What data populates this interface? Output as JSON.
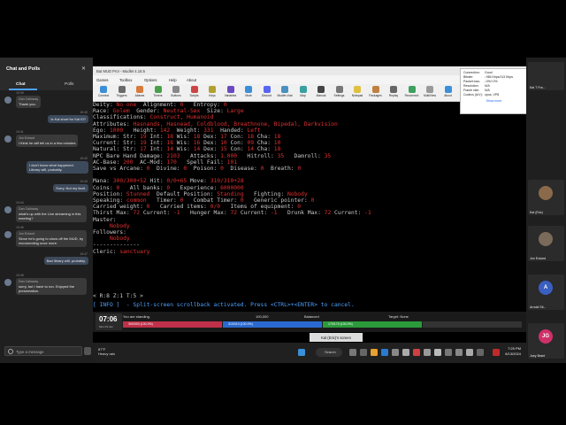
{
  "chat": {
    "title": "Chat and Polls",
    "tabs": [
      "Chat",
      "Polls"
    ],
    "messages": [
      {
        "time": "19:39",
        "sender": "Dan Calloway",
        "text": "Thank you.",
        "me": false
      },
      {
        "time": "19:40",
        "sender": "",
        "text": "Is Kal short for Kal El?",
        "me": true
      },
      {
        "time": "19:41",
        "sender": "Jon Eckard",
        "text": "I think he will tell us in a few minutes",
        "me": false
      },
      {
        "time": "19:42",
        "sender": "",
        "text": "I don't know what happened. Library wifi, probably.",
        "me": true
      },
      {
        "time": "19:43",
        "sender": "",
        "text": "Sorry. Not my fault.",
        "me": true
      },
      {
        "time": "19:44",
        "sender": "Dan Calloway",
        "text": "what's up with the Live streaming in this meeting?",
        "me": false
      },
      {
        "time": "19:45",
        "sender": "Jon Eckard",
        "text": "Since he's going to show off the MUD, try reconnecting once more.",
        "me": false
      },
      {
        "time": "19:47",
        "sender": "",
        "text": "Bad library wifi, probably.",
        "me": true
      },
      {
        "time": "19:48",
        "sender": "Dan Calloway",
        "text": "sorry, but I have to run. Enjoyed the presentation.",
        "me": false
      }
    ],
    "input_placeholder": "Type a message"
  },
  "window": {
    "title": "Bat MUD Pro! - Mudlet 4.18.5",
    "recording_label": "Scrcap",
    "recording_time": "1:59:52",
    "close": "×",
    "menu": [
      "Games",
      "Toolbox",
      "Options",
      "Help",
      "About"
    ],
    "toolbar": [
      {
        "label": "Connect",
        "color": "#3a8fd8"
      },
      {
        "label": "Triggers",
        "color": "#6a6a6a"
      },
      {
        "label": "Aliases",
        "color": "#d87a3a"
      },
      {
        "label": "Timers",
        "color": "#4aa04a"
      },
      {
        "label": "Buttons",
        "color": "#888888"
      },
      {
        "label": "Scripts",
        "color": "#cc4444"
      },
      {
        "label": "Keys",
        "color": "#b0a030"
      },
      {
        "label": "Variables",
        "color": "#6a4ac0"
      },
      {
        "label": "Mute",
        "color": "#3a8fd8"
      },
      {
        "label": "Discord",
        "color": "#5865f2"
      },
      {
        "label": "Mudlet chat",
        "color": "#4a90c0"
      },
      {
        "label": "Map",
        "color": "#3aa0a0"
      },
      {
        "label": "Manual",
        "color": "#444444"
      },
      {
        "label": "Settings",
        "color": "#777777"
      },
      {
        "label": "Notepad",
        "color": "#e0c040"
      },
      {
        "label": "Packages",
        "color": "#c08040"
      },
      {
        "label": "Replay",
        "color": "#666666"
      },
      {
        "label": "Reconnect",
        "color": "#40a060"
      },
      {
        "label": "MultiView",
        "color": "#999999"
      },
      {
        "label": "About",
        "color": "#3a8fd8"
      }
    ]
  },
  "terminal": {
    "lines": [
      [
        [
          "Deity: ",
          "w"
        ],
        [
          "No one",
          "r"
        ],
        [
          "  Alignment: ",
          "w"
        ],
        [
          "0",
          "r"
        ],
        [
          "   Entropy: ",
          "w"
        ],
        [
          "0",
          "r"
        ]
      ],
      [
        [
          "Race: ",
          "w"
        ],
        [
          "Golem",
          "r"
        ],
        [
          "  Gender: ",
          "w"
        ],
        [
          "Neutral-Sex",
          "r"
        ],
        [
          "  Size: ",
          "w"
        ],
        [
          "Large",
          "r"
        ]
      ],
      [
        [
          "Classifications: ",
          "w"
        ],
        [
          "Construct, Humanoid",
          "r"
        ]
      ],
      [
        [
          "Attributes: ",
          "w"
        ],
        [
          "Hasnands, Hasnead, Coldblood, Breathnone, Bipedal, Darkvision",
          "r"
        ]
      ],
      [
        [
          "Ego: ",
          "w"
        ],
        [
          "1000",
          "r"
        ],
        [
          "   Height: ",
          "w"
        ],
        [
          "142",
          "r"
        ],
        [
          "  Weight: ",
          "w"
        ],
        [
          "331",
          "r"
        ],
        [
          "  Handed: ",
          "w"
        ],
        [
          "Left",
          "r"
        ]
      ],
      [
        [
          "Maximum: Str: ",
          "w"
        ],
        [
          "19",
          "r"
        ],
        [
          " Int: ",
          "w"
        ],
        [
          "18",
          "r"
        ],
        [
          " Wis: ",
          "w"
        ],
        [
          "18",
          "r"
        ],
        [
          " Dex: ",
          "w"
        ],
        [
          "17",
          "r"
        ],
        [
          " Con: ",
          "w"
        ],
        [
          "18",
          "r"
        ],
        [
          " Cha: ",
          "w"
        ],
        [
          "18",
          "r"
        ]
      ],
      [
        [
          "Current: Str: ",
          "w"
        ],
        [
          "19",
          "r"
        ],
        [
          " Int: ",
          "w"
        ],
        [
          "18",
          "r"
        ],
        [
          " Wis: ",
          "w"
        ],
        [
          "16",
          "r"
        ],
        [
          " Dex: ",
          "w"
        ],
        [
          "10",
          "r"
        ],
        [
          " Con: ",
          "w"
        ],
        [
          "09",
          "r"
        ],
        [
          " Cha: ",
          "w"
        ],
        [
          "10",
          "r"
        ]
      ],
      [
        [
          "Natural: Str: ",
          "w"
        ],
        [
          "17",
          "r"
        ],
        [
          " Int: ",
          "w"
        ],
        [
          "14",
          "r"
        ],
        [
          " Wis: ",
          "w"
        ],
        [
          "14",
          "r"
        ],
        [
          " Dex: ",
          "w"
        ],
        [
          "15",
          "r"
        ],
        [
          " Con: ",
          "w"
        ],
        [
          "14",
          "r"
        ],
        [
          " Cha: ",
          "w"
        ],
        [
          "18",
          "r"
        ]
      ],
      [
        [
          "NPC Bare Hand Damage: ",
          "w"
        ],
        [
          "2103",
          "r"
        ],
        [
          "   Attacks: ",
          "w"
        ],
        [
          "1.000",
          "r"
        ],
        [
          "   Hitroll: ",
          "w"
        ],
        [
          "35",
          "r"
        ],
        [
          "   Damroll: ",
          "w"
        ],
        [
          "35",
          "r"
        ]
      ],
      [
        [
          "AC-Base: ",
          "w"
        ],
        [
          "200",
          "r"
        ],
        [
          "  AC-Mod: ",
          "w"
        ],
        [
          "170",
          "r"
        ],
        [
          "   Spell Fail: ",
          "w"
        ],
        [
          "101",
          "r"
        ]
      ],
      [
        [
          "Save vs Arcane: ",
          "w"
        ],
        [
          "0",
          "r"
        ],
        [
          "  Divine: ",
          "w"
        ],
        [
          "0",
          "r"
        ],
        [
          "  Poison: ",
          "w"
        ],
        [
          "0",
          "r"
        ],
        [
          "  Disease: ",
          "w"
        ],
        [
          "0",
          "r"
        ],
        [
          "  Breath: ",
          "w"
        ],
        [
          "0",
          "r"
        ]
      ],
      [
        [
          "",
          "w"
        ]
      ],
      [
        [
          "Mana: ",
          "w"
        ],
        [
          "300/300+52",
          "r"
        ],
        [
          " Hit: ",
          "w"
        ],
        [
          "0/0+65",
          "r"
        ],
        [
          " Move: ",
          "w"
        ],
        [
          "310/310+28",
          "r"
        ]
      ],
      [
        [
          "Coins: ",
          "w"
        ],
        [
          "0",
          "r"
        ],
        [
          "   All banks: ",
          "w"
        ],
        [
          "0",
          "r"
        ],
        [
          "   Experience: ",
          "w"
        ],
        [
          "6000000",
          "r"
        ]
      ],
      [
        [
          "Position: ",
          "w"
        ],
        [
          "Stunned",
          "r"
        ],
        [
          "  Default Position: ",
          "w"
        ],
        [
          "Standing",
          "r"
        ],
        [
          "   Fighting: ",
          "w"
        ],
        [
          "Nobody",
          "r"
        ]
      ],
      [
        [
          "Speaking: ",
          "w"
        ],
        [
          "common",
          "r"
        ],
        [
          "   Timer: ",
          "w"
        ],
        [
          "0",
          "r"
        ],
        [
          "   Combat Timer: ",
          "w"
        ],
        [
          "0",
          "r"
        ],
        [
          "   Generic pointer: ",
          "w"
        ],
        [
          "0",
          "r"
        ]
      ],
      [
        [
          "Carried weight: ",
          "w"
        ],
        [
          "0",
          "r"
        ],
        [
          "   Carried items: ",
          "w"
        ],
        [
          "0/0",
          "r"
        ],
        [
          "   Items of equipment: ",
          "w"
        ],
        [
          "0",
          "r"
        ]
      ],
      [
        [
          "Thirst Max: ",
          "w"
        ],
        [
          "72",
          "r"
        ],
        [
          " Current: ",
          "w"
        ],
        [
          "-1",
          "r"
        ],
        [
          "   Hunger Max: ",
          "w"
        ],
        [
          "72",
          "r"
        ],
        [
          " Current: ",
          "w"
        ],
        [
          "-1",
          "r"
        ],
        [
          "   Drunk Max: ",
          "w"
        ],
        [
          "72",
          "r"
        ],
        [
          " Current: ",
          "w"
        ],
        [
          "-1",
          "r"
        ]
      ],
      [
        [
          "Master:",
          "w"
        ]
      ],
      [
        [
          "     ",
          "w"
        ],
        [
          "Nobody",
          "r"
        ]
      ],
      [
        [
          "Followers:",
          "w"
        ]
      ],
      [
        [
          "     ",
          "w"
        ],
        [
          "Nobody",
          "r"
        ]
      ],
      [
        [
          "--------------",
          "w"
        ]
      ],
      [
        [
          "Cleric: ",
          "w"
        ],
        [
          "sanctuary",
          "r"
        ]
      ]
    ],
    "prompt": "< R:8 Z:1 T:5 >",
    "info": "[ INFO ]  - Split-screen scrollback activated. Press <CTRL>+<ENTER> to cancel."
  },
  "status": {
    "time": "07:06",
    "date": "Mon 03 Jan",
    "standing": "You are standing.",
    "gold": "100,000",
    "alignment": "Balanced",
    "target": "Target: None",
    "bars": [
      {
        "label": "300/300 (100.0%)",
        "color": "#c0304a",
        "fill": 1.0
      },
      {
        "label": "310/310 (100.0%)",
        "color": "#2a6ad0",
        "fill": 1.0
      },
      {
        "label": "170/170 (100.0%)",
        "color": "#2a9a3a",
        "fill": 1.0
      },
      {
        "label": "",
        "color": "#c8a020",
        "fill": 0.0
      }
    ]
  },
  "taskbar": {
    "weather_temp": "87°F",
    "weather_desc": "Heavy rain",
    "search": "Search",
    "clock": "7:25 PM",
    "date": "6/13/2024",
    "shared_by": "Kal (Eric)'s screen"
  },
  "connection": {
    "title": "Connection:",
    "status": "Good",
    "rows": [
      {
        "k": "Bitrate:",
        "v": "↓984 Kbps/113 Kbps"
      },
      {
        "k": "Packet loss:",
        "v": "↓0%/↑0%"
      },
      {
        "k": "Resolution:",
        "v": "N/A"
      },
      {
        "k": "Frame rate:",
        "v": "N/A"
      },
      {
        "k": "Codecs (A/V):",
        "v": "opus, VP8"
      }
    ],
    "more": "Show more"
  },
  "participants": [
    {
      "name": "Kal (Eric)",
      "initials": "",
      "color": "#8a6a4a"
    },
    {
      "name": "Jon Eckard",
      "initials": "",
      "color": "#7a6a5a"
    },
    {
      "name": "Arnold Sil...",
      "initials": "A",
      "color": "#3a5fc0"
    },
    {
      "name": "Joey Brant",
      "initials": "JG",
      "color": "#d0306a"
    }
  ],
  "top_participant": "Kal T Fra..."
}
